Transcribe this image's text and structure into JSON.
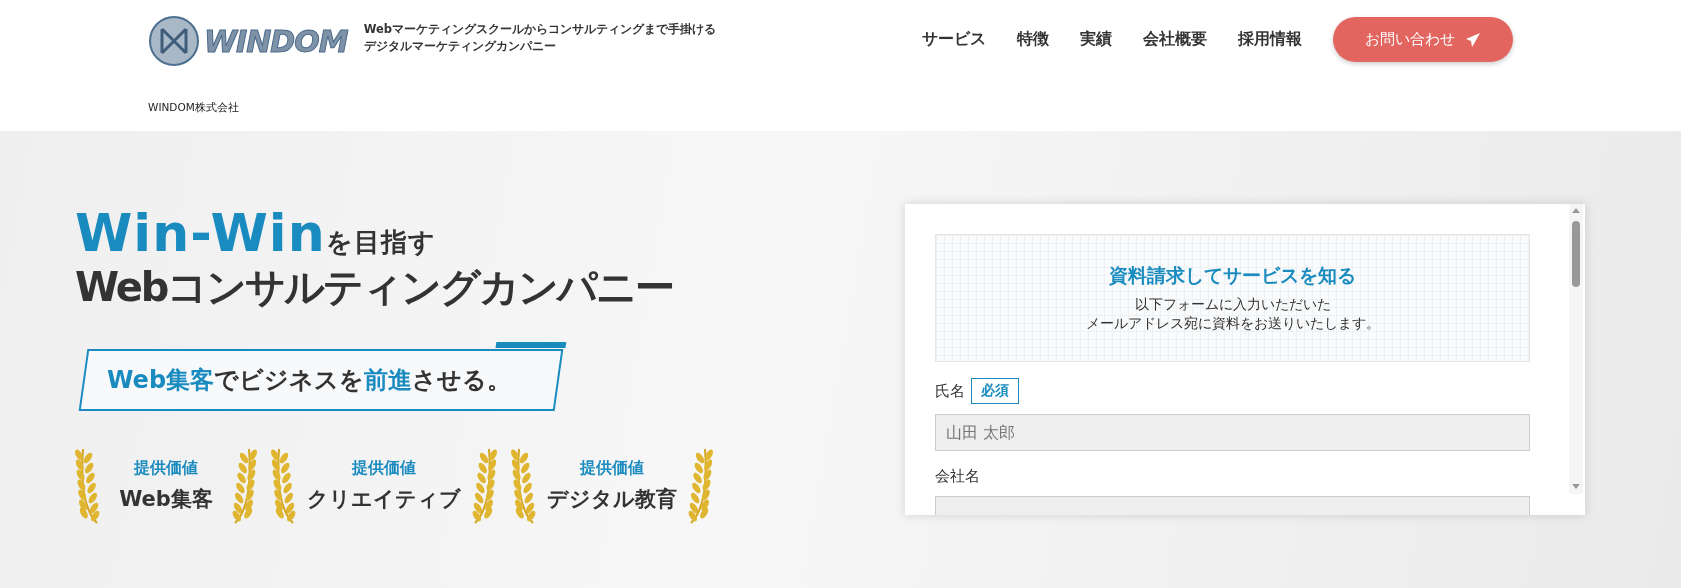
{
  "header": {
    "logo_text": "WINDOM",
    "tagline": [
      "Webマーケティングスクールからコンサルティングまで手掛ける",
      "デジタルマーケティングカンパニー"
    ],
    "company_name": "WINDOM株式会社",
    "nav": [
      "サービス",
      "特徴",
      "実績",
      "会社概要",
      "採用情報"
    ],
    "contact_button": "お問い合わせ"
  },
  "hero": {
    "headline": [
      [
        {
          "text": "Win-Win",
          "accent": true
        },
        {
          "text": "を目指す",
          "accent": false
        }
      ],
      [
        {
          "text": "Webコンサルティングカンパニー",
          "accent": false
        }
      ]
    ],
    "banner": [
      {
        "text": "Web集客",
        "accent": true
      },
      {
        "text": "でビジネスを",
        "accent": false
      },
      {
        "text": "前進",
        "accent": true
      },
      {
        "text": "させる。",
        "accent": false
      }
    ],
    "values": [
      {
        "label": "提供価値",
        "value": "Web集客"
      },
      {
        "label": "提供価値",
        "value": "クリエイティブ"
      },
      {
        "label": "提供価値",
        "value": "デジタル教育"
      }
    ]
  },
  "form": {
    "title": "資料請求してサービスを知る",
    "intro": [
      "以下フォームに入力いただいた",
      "メールアドレス宛に資料をお送りいたします。"
    ],
    "fields": [
      {
        "label": "氏名",
        "required": true,
        "required_text": "必須",
        "placeholder": "山田 太郎"
      },
      {
        "label": "会社名",
        "required": false
      }
    ]
  }
}
